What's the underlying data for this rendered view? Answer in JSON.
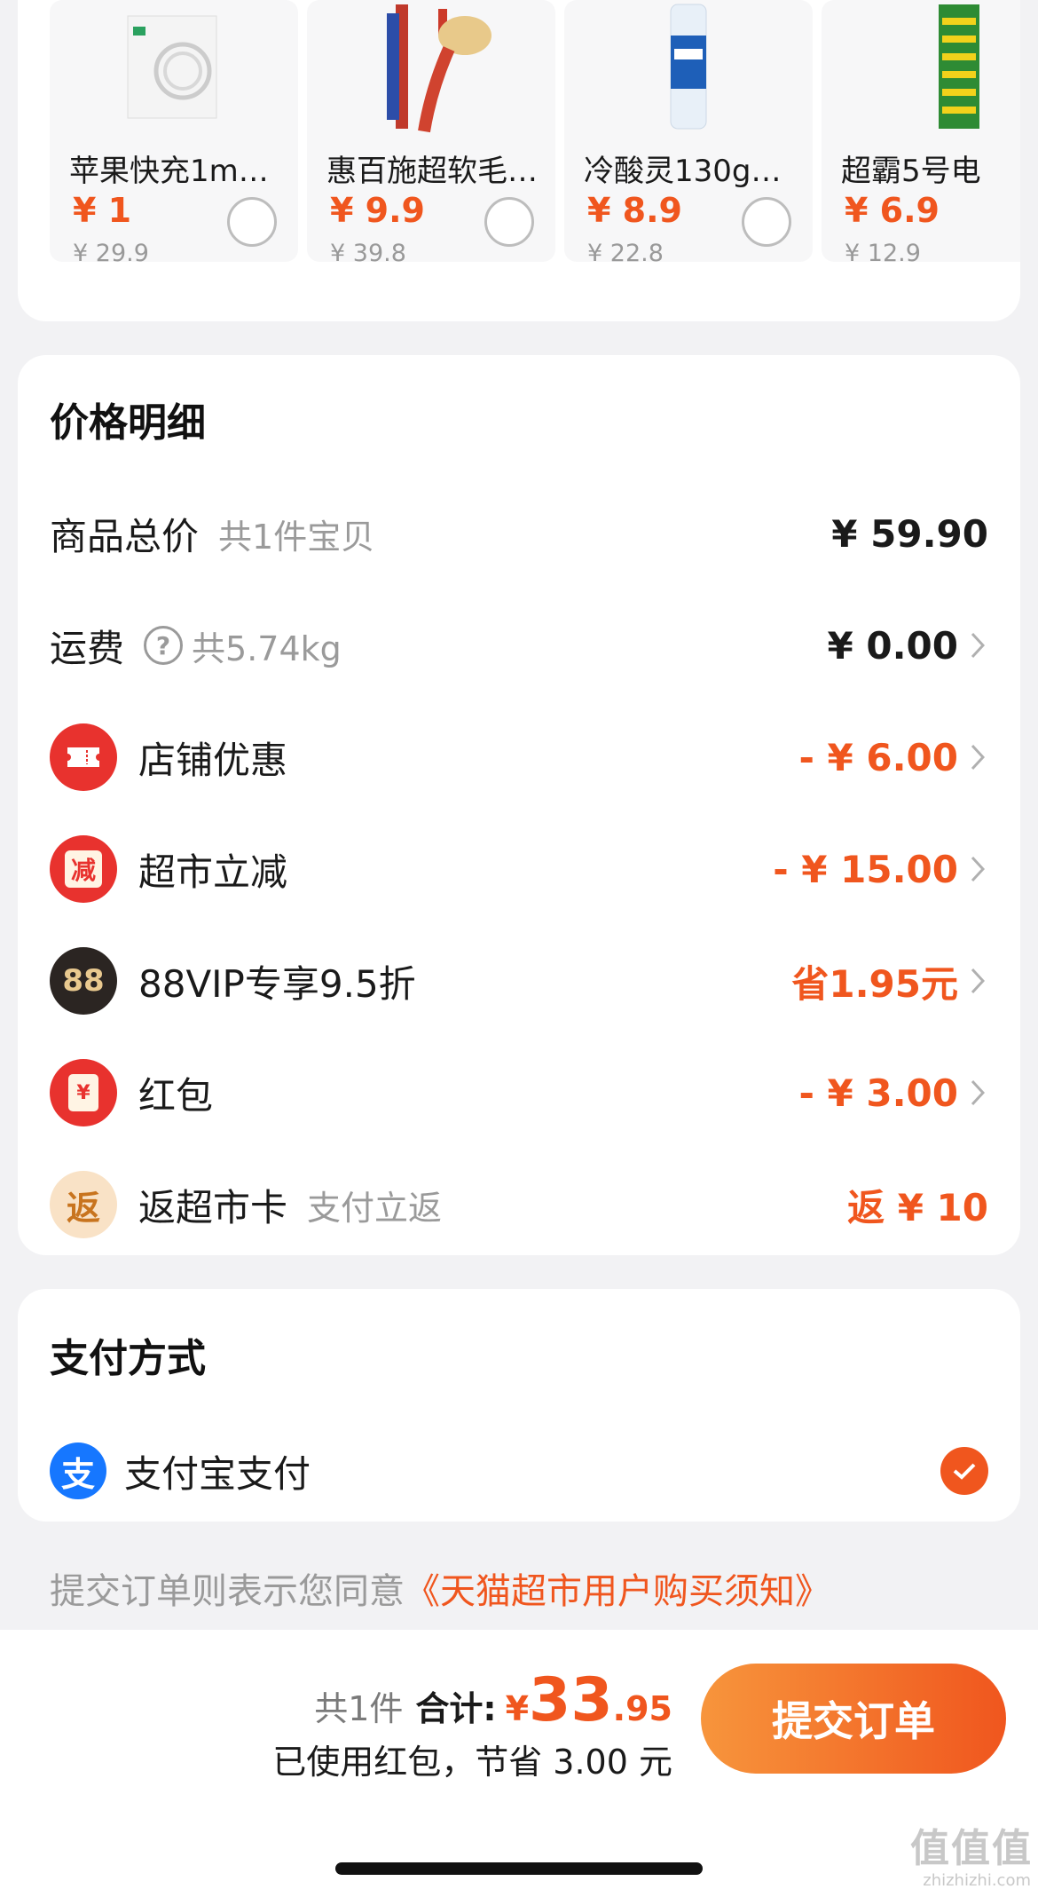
{
  "products": [
    {
      "name": "苹果快充1m…",
      "price": "¥ 1",
      "original": "¥ 29.9",
      "icon": "usb-cable-image"
    },
    {
      "name": "惠百施超软毛…",
      "price": "¥ 9.9",
      "original": "¥ 39.8",
      "icon": "toothbrush-image"
    },
    {
      "name": "冷酸灵130g…",
      "price": "¥ 8.9",
      "original": "¥ 22.8",
      "icon": "toothpaste-image"
    },
    {
      "name": "超霸5号电",
      "price": "¥ 6.9",
      "original": "¥ 12.9",
      "icon": "battery-image"
    }
  ],
  "price_detail": {
    "title": "价格明细",
    "goods_total": {
      "label": "商品总价",
      "sub": "共1件宝贝",
      "amount": "¥ 59.90"
    },
    "shipping": {
      "label": "运费",
      "sub": "共5.74kg",
      "amount": "¥ 0.00"
    },
    "shop_discount": {
      "label": "店铺优惠",
      "amount": "- ¥ 6.00"
    },
    "market_cut": {
      "label": "超市立减",
      "icon_text": "减",
      "amount": "- ¥ 15.00"
    },
    "vip": {
      "label": "88VIP专享9.5折",
      "icon_text": "88",
      "amount": "省1.95元"
    },
    "red_packet": {
      "label": "红包",
      "icon_text": "¥",
      "amount": "- ¥ 3.00"
    },
    "rebate": {
      "label": "返超市卡",
      "sub": "支付立返",
      "icon_text": "返",
      "amount": "返 ¥ 10"
    }
  },
  "payment": {
    "title": "支付方式",
    "method": "支付宝支付",
    "icon_text": "支"
  },
  "agreement": {
    "prefix": "提交订单则表示您同意",
    "link": "《天猫超市用户购买须知》"
  },
  "summary": {
    "count": "共1件",
    "total_label": "合计:",
    "yen": "¥",
    "total_main": "33",
    "total_cents": ".95",
    "saved": "已使用红包，节省 3.00 元",
    "submit_label": "提交订单"
  },
  "watermark": {
    "text": "值值值",
    "sub": "zhizhizhi.com"
  },
  "colors": {
    "accent": "#f0561e",
    "red_icon": "#e8322e",
    "vip_dark": "#2b2522",
    "alipay_blue": "#1677ff"
  }
}
